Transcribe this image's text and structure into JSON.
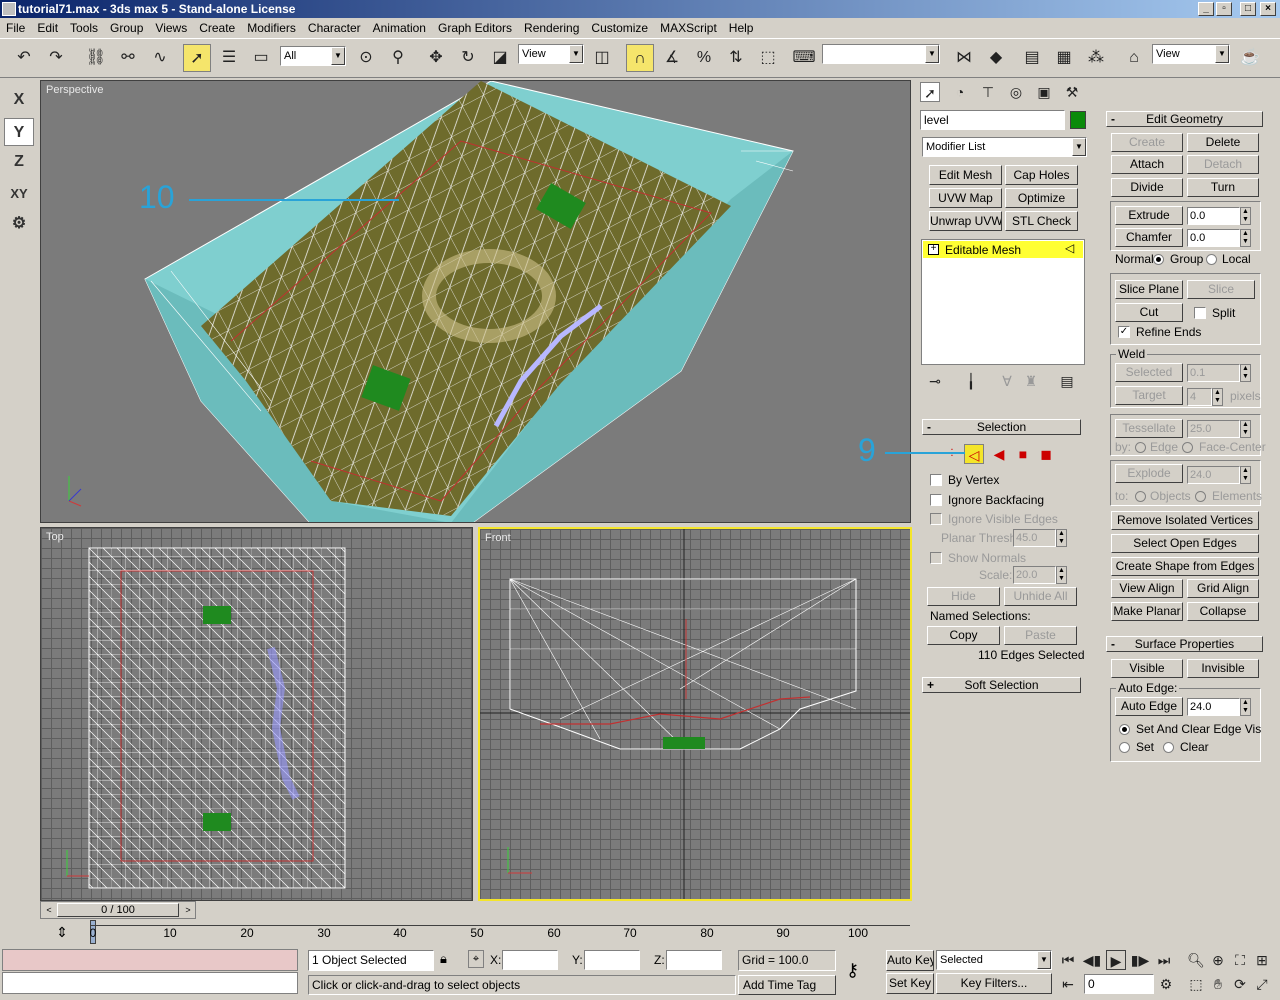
{
  "window": {
    "title": "tutorial71.max - 3ds max 5 - Stand-alone License"
  },
  "menu": [
    "File",
    "Edit",
    "Tools",
    "Group",
    "Views",
    "Create",
    "Modifiers",
    "Character",
    "Animation",
    "Graph Editors",
    "Rendering",
    "Customize",
    "MAXScript",
    "Help"
  ],
  "toolbar": {
    "selection_filter": "All",
    "ref_coord": "View",
    "named_selection": "",
    "render_type": "View"
  },
  "axis_constraints": [
    "X",
    "Y",
    "Z",
    "XY"
  ],
  "viewports": {
    "perspective": "Perspective",
    "top": "Top",
    "front": "Front"
  },
  "annotations": {
    "callout_10": "10",
    "callout_9": "9"
  },
  "command_panel": {
    "object_name": "level",
    "object_color": "#0a8a0a",
    "modifier_list": "Modifier List",
    "modifier_buttons": [
      "Edit Mesh",
      "Cap Holes",
      "UVW Map",
      "Optimize",
      "Unwrap UVW",
      "STL Check"
    ],
    "stack_item": "Editable Mesh",
    "selection": {
      "title": "Selection",
      "by_vertex": "By Vertex",
      "ignore_backfacing": "Ignore Backfacing",
      "ignore_visible_edges": "Ignore Visible Edges",
      "planar_thresh_label": "Planar Thresh:",
      "planar_thresh": "45.0",
      "show_normals": "Show Normals",
      "scale_label": "Scale:",
      "scale": "20.0",
      "hide": "Hide",
      "unhide_all": "Unhide All",
      "named_selections": "Named Selections:",
      "copy": "Copy",
      "paste": "Paste",
      "status": "110 Edges Selected"
    },
    "soft_selection": "Soft Selection"
  },
  "edit_geometry": {
    "title": "Edit Geometry",
    "create": "Create",
    "delete": "Delete",
    "attach": "Attach",
    "detach": "Detach",
    "divide": "Divide",
    "turn": "Turn",
    "extrude": "Extrude",
    "extrude_val": "0.0",
    "chamfer": "Chamfer",
    "chamfer_val": "0.0",
    "normal_label": "Normal:",
    "group": "Group",
    "local": "Local",
    "slice_plane": "Slice Plane",
    "slice": "Slice",
    "cut": "Cut",
    "split": "Split",
    "refine_ends": "Refine Ends",
    "weld": "Weld",
    "selected": "Selected",
    "selected_val": "0.1",
    "target": "Target",
    "target_val": "4",
    "pixels": "pixels",
    "tessellate": "Tessellate",
    "tess_val": "25.0",
    "by_label": "by:",
    "edge": "Edge",
    "face_center": "Face-Center",
    "explode": "Explode",
    "explode_val": "24.0",
    "to_label": "to:",
    "objects": "Objects",
    "elements": "Elements",
    "remove_isolated": "Remove Isolated Vertices",
    "select_open_edges": "Select Open Edges",
    "create_shape": "Create Shape from Edges",
    "view_align": "View Align",
    "grid_align": "Grid Align",
    "make_planar": "Make Planar",
    "collapse": "Collapse"
  },
  "surface_properties": {
    "title": "Surface Properties",
    "visible": "Visible",
    "invisible": "Invisible",
    "auto_edge_label": "Auto Edge:",
    "auto_edge": "Auto Edge",
    "auto_edge_val": "24.0",
    "set_and_clear": "Set And Clear Edge Vis",
    "set": "Set",
    "clear": "Clear"
  },
  "timeline": {
    "frame_counter": "0 / 100",
    "ticks": [
      "0",
      "10",
      "20",
      "30",
      "40",
      "50",
      "60",
      "70",
      "80",
      "90",
      "100"
    ]
  },
  "status": {
    "selection_info": "1 Object Selected",
    "prompt": "Click or click-and-drag to select objects",
    "x_label": "X:",
    "y_label": "Y:",
    "z_label": "Z:",
    "grid": "Grid = 100.0",
    "add_time_tag": "Add Time Tag",
    "auto_key": "Auto Key",
    "set_key": "Set Key",
    "key_mode": "Selected",
    "key_filters": "Key Filters...",
    "frame": "0"
  }
}
